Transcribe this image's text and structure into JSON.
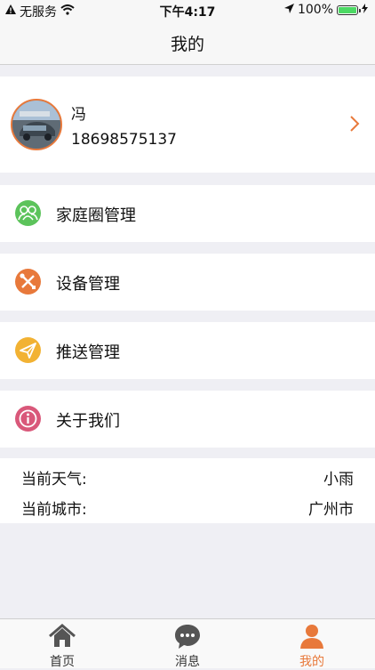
{
  "status_bar": {
    "carrier": "无服务",
    "time": "下午4:17",
    "battery": "100%"
  },
  "nav": {
    "title": "我的"
  },
  "profile": {
    "name": "冯",
    "phone": "18698575137"
  },
  "menu": [
    {
      "label": "家庭圈管理",
      "icon": "family-circle-icon",
      "color": "#5cc35b"
    },
    {
      "label": "设备管理",
      "icon": "device-tools-icon",
      "color": "#e8793b"
    },
    {
      "label": "推送管理",
      "icon": "paper-plane-icon",
      "color": "#f2b233"
    },
    {
      "label": "关于我们",
      "icon": "info-icon",
      "color": "#d9587a"
    }
  ],
  "weather": {
    "weather_label": "当前天气:",
    "weather_value": "小雨",
    "city_label": "当前城市:",
    "city_value": "广州市"
  },
  "tabbar": [
    {
      "label": "首页",
      "icon": "home-icon",
      "active": false
    },
    {
      "label": "消息",
      "icon": "message-icon",
      "active": false
    },
    {
      "label": "我的",
      "icon": "person-icon",
      "active": true
    }
  ],
  "colors": {
    "accent": "#e8793b",
    "inactive": "#555555"
  }
}
